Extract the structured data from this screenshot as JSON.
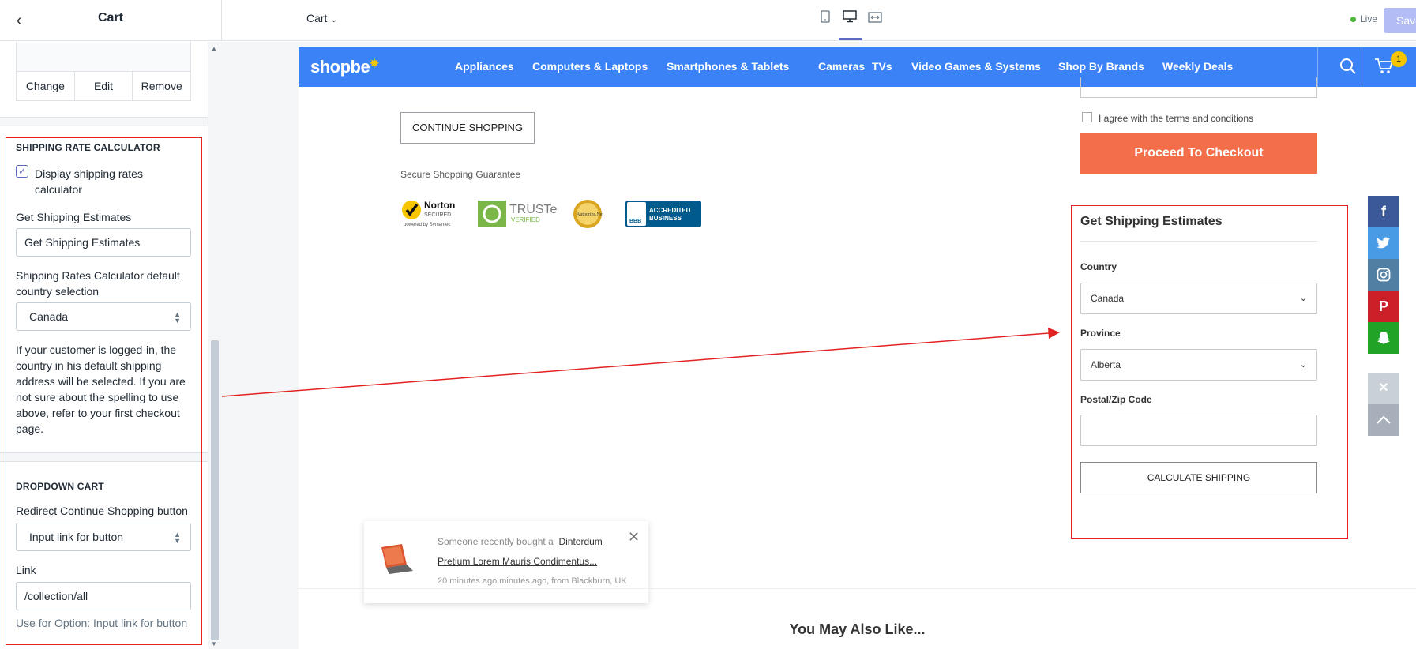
{
  "topbar": {
    "title": "Cart",
    "template_select": "Cart",
    "live_label": "Live",
    "save_label": "Save"
  },
  "sidebar": {
    "image_actions": [
      "Change",
      "Edit",
      "Remove"
    ],
    "shipping_section": {
      "title": "SHIPPING RATE CALCULATOR",
      "checkbox_label_line1": "Display shipping rates",
      "checkbox_label_line2": "calculator",
      "checkbox_checked": true,
      "estimates_label": "Get Shipping Estimates",
      "estimates_value": "Get Shipping Estimates",
      "country_label_line1": "Shipping Rates Calculator default",
      "country_label_line2": "country selection",
      "country_value": "Canada",
      "help_lines": [
        "If your customer is logged-in, the",
        "country in his default shipping",
        "address will be selected. If you are",
        "not sure about the spelling to use",
        "above, refer to your first checkout",
        "page."
      ]
    },
    "dropdown_section": {
      "title": "DROPDOWN CART",
      "redirect_label": "Redirect Continue Shopping button",
      "redirect_value": "Input link for button",
      "link_label": "Link",
      "link_value": "/collection/all",
      "link_help": "Use for Option: Input link for button"
    }
  },
  "store": {
    "logo": "shopbe",
    "nav": [
      "Appliances",
      "Computers & Laptops",
      "Smartphones & Tablets",
      "Cameras",
      "TVs",
      "Video Games & Systems",
      "Shop By Brands",
      "Weekly Deals"
    ],
    "cart_count": "1",
    "continue_shopping": "CONTINUE SHOPPING",
    "secure_label": "Secure Shopping Guarantee",
    "trust_badges": {
      "norton": "Norton",
      "norton_sub": "SECURED",
      "norton_powered": "powered by Symantec",
      "truste": "TRUSTe",
      "truste_sub": "VERIFIED",
      "authorize": "Authorize.Net",
      "bbb": "BBB",
      "bbb_text1": "ACCREDITED",
      "bbb_text2": "BUSINESS"
    },
    "terms": "I agree with the terms and conditions",
    "checkout": "Proceed To Checkout",
    "estimates": {
      "title": "Get Shipping Estimates",
      "country_label": "Country",
      "country_value": "Canada",
      "province_label": "Province",
      "province_value": "Alberta",
      "zip_label": "Postal/Zip Code",
      "calc_button": "CALCULATE SHIPPING"
    },
    "notification": {
      "prefix": "Someone recently bought a",
      "product_line1": "Dinterdum",
      "product_line2": "Pretium Lorem Mauris Condimentus...",
      "meta": "20 minutes ago minutes ago, from Blackburn, UK"
    },
    "you_may_also_like": "You May Also Like...",
    "social": [
      "facebook",
      "twitter",
      "instagram",
      "pinterest",
      "snapchat"
    ],
    "colors": {
      "nav": "#3b82f6",
      "checkout": "#f36f4a",
      "facebook": "#3b5998",
      "twitter": "#4a9be6",
      "instagram": "#517fa4",
      "pinterest": "#cb2027",
      "snapchat": "#21a327"
    }
  }
}
